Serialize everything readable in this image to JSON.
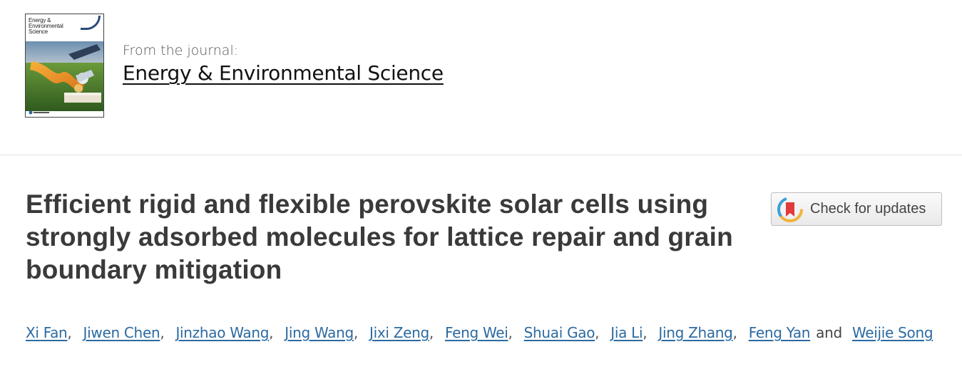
{
  "journal": {
    "from_label": "From the journal:",
    "name": "Energy & Environmental Science",
    "cover_title": "Energy & Environmental Science"
  },
  "article": {
    "title": "Efficient rigid and flexible perovskite solar cells using strongly adsorbed molecules for lattice repair and grain boundary mitigation"
  },
  "check_for_updates": {
    "label": "Check for updates"
  },
  "authors": {
    "list": [
      "Xi Fan",
      "Jiwen Chen",
      "Jinzhao Wang",
      "Jing Wang",
      "Jixi Zeng",
      "Feng Wei",
      "Shuai Gao",
      "Jia Li",
      "Jing Zhang",
      "Feng Yan",
      "Weijie Song"
    ],
    "and_label": "and",
    "separator": ","
  },
  "colors": {
    "link": "#2c6aa0",
    "title": "#3a3a3a"
  }
}
